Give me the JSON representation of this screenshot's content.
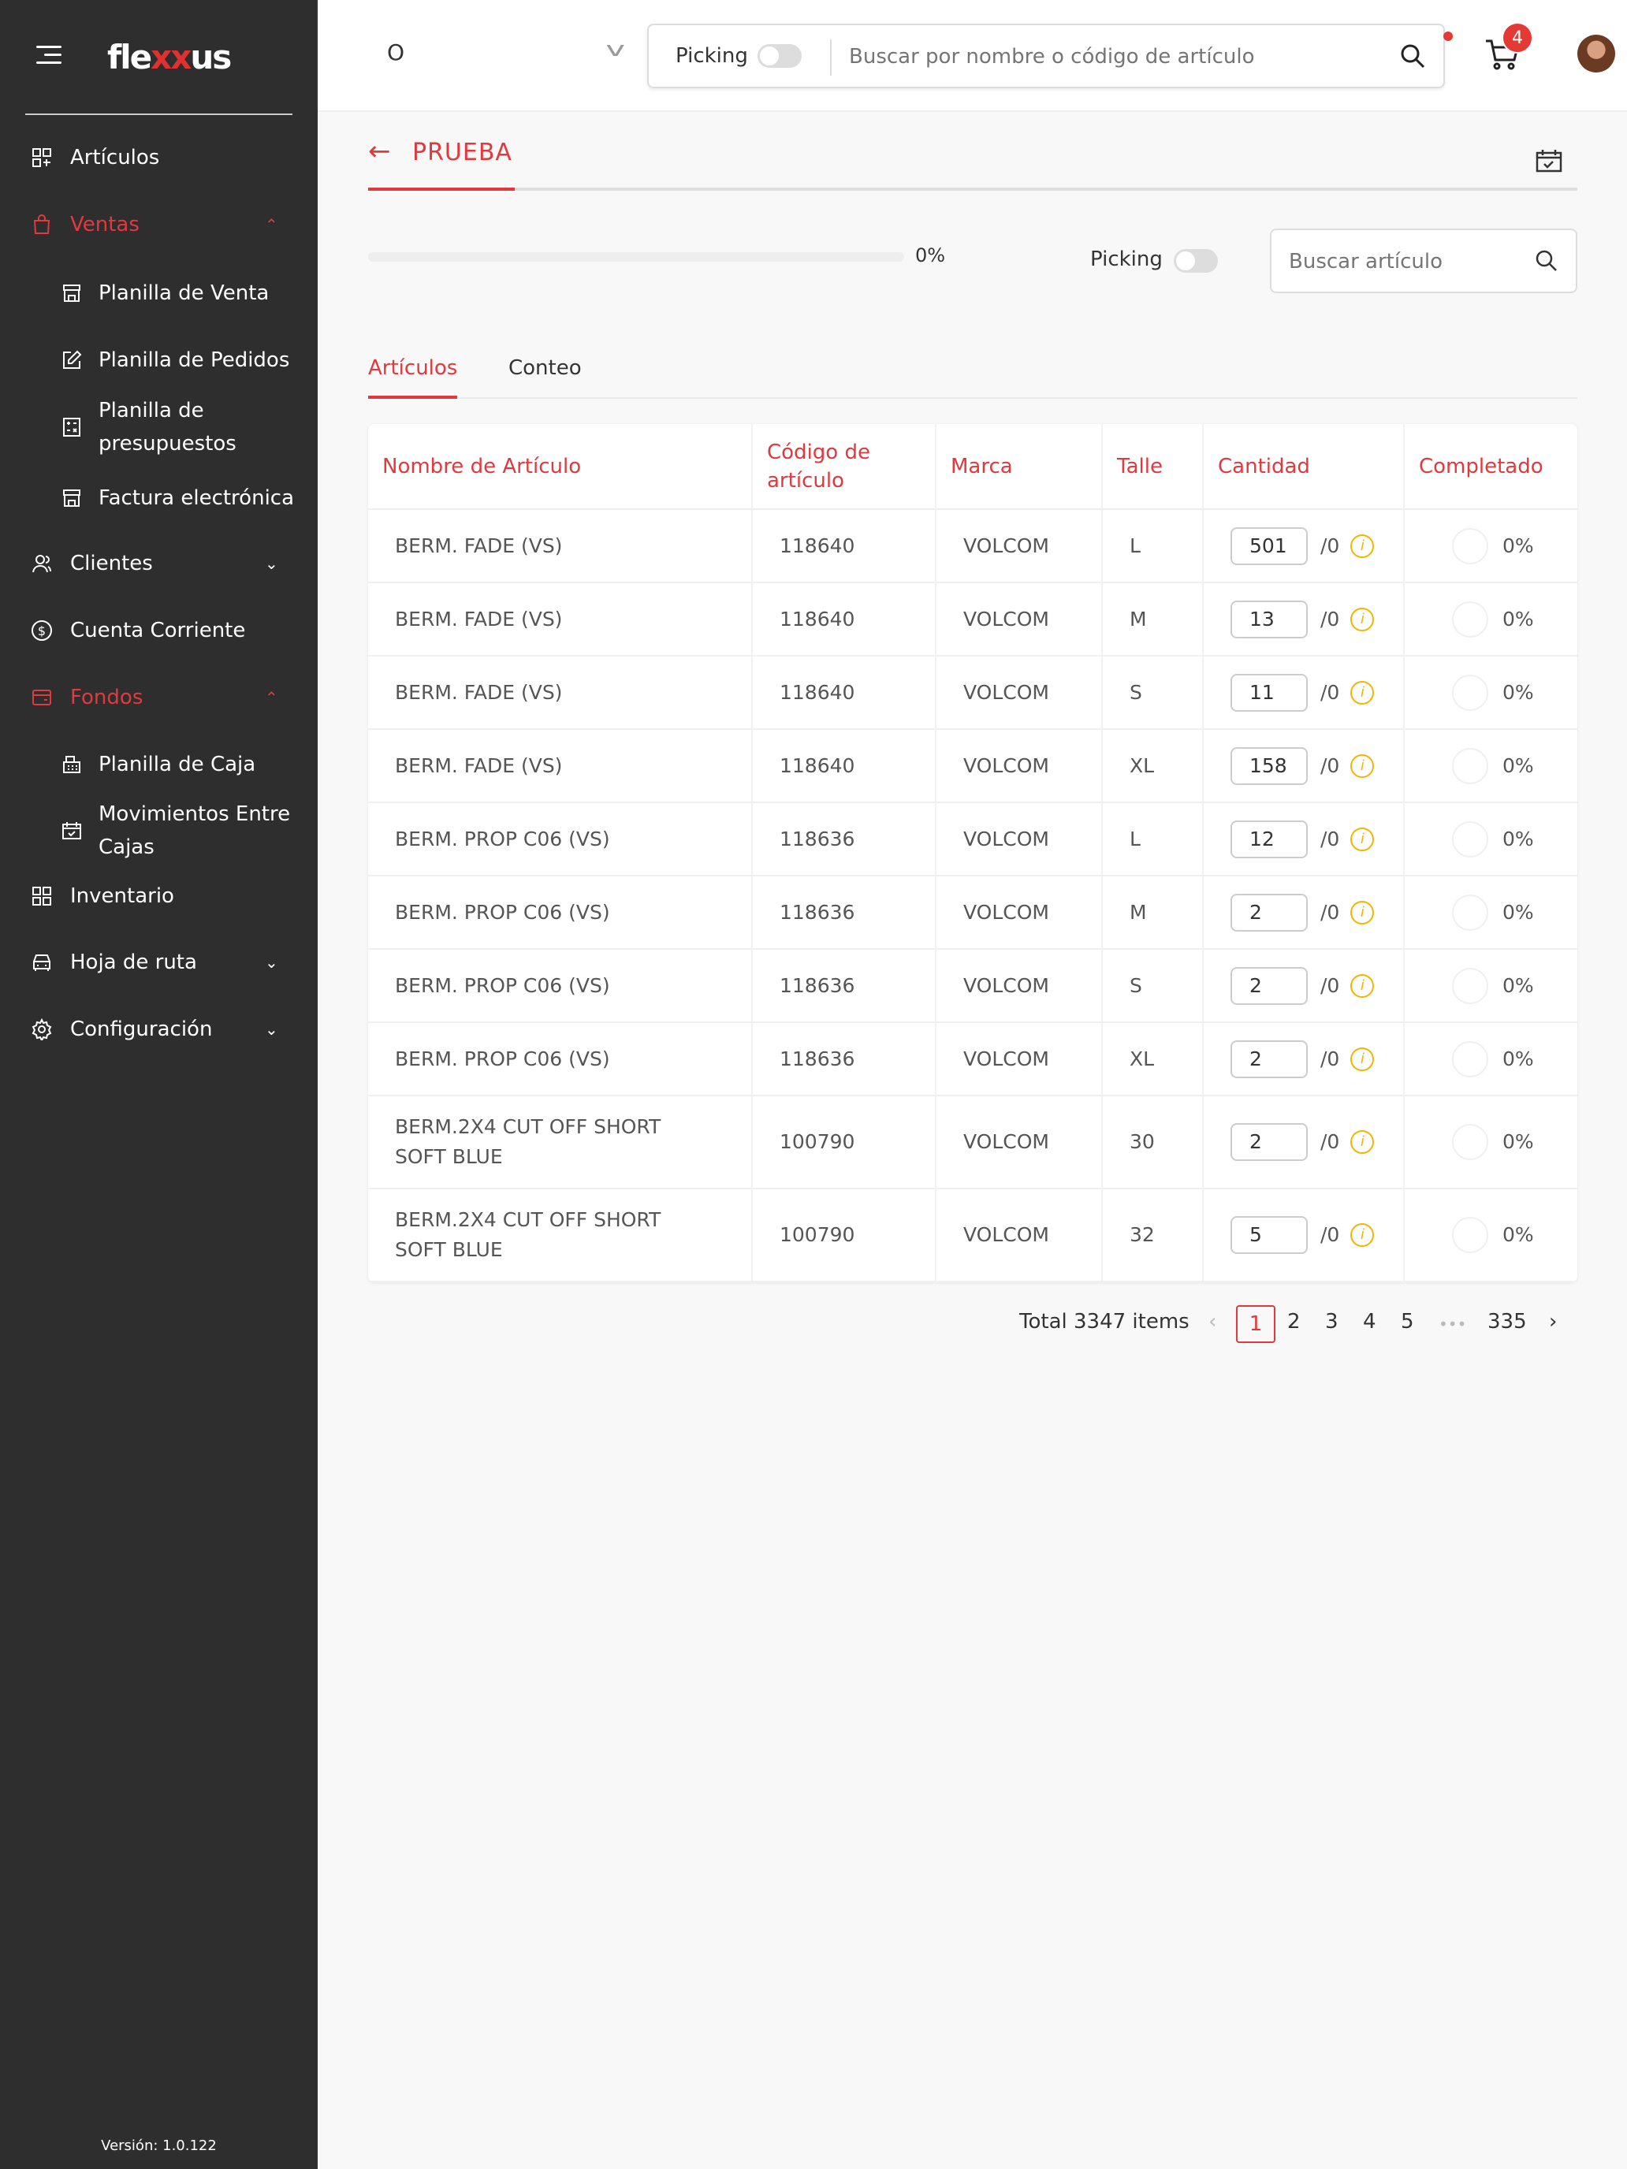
{
  "app": {
    "logo": "flexxus",
    "version": "Versión: 1.0.122"
  },
  "sidebar": {
    "items": [
      {
        "label": "Artículos",
        "icon": "grid-add-icon"
      },
      {
        "label": "Ventas",
        "icon": "bag-icon",
        "active": true,
        "expanded": true
      },
      {
        "label": "Planilla de Venta",
        "icon": "store-icon"
      },
      {
        "label": "Planilla de Pedidos",
        "icon": "edit-icon"
      },
      {
        "label": "Planilla de presupuestos",
        "icon": "calculator-icon"
      },
      {
        "label": "Factura electrónica",
        "icon": "store-icon"
      },
      {
        "label": "Clientes",
        "icon": "users-icon"
      },
      {
        "label": "Cuenta Corriente",
        "icon": "dollar-icon"
      },
      {
        "label": "Fondos",
        "icon": "wallet-icon",
        "active": true,
        "expanded": true
      },
      {
        "label": "Planilla de Caja",
        "icon": "cash-register-icon"
      },
      {
        "label": "Movimientos Entre Cajas",
        "icon": "calendar-check-icon"
      },
      {
        "label": "Inventario",
        "icon": "grid-icon"
      },
      {
        "label": "Hoja de ruta",
        "icon": "car-icon"
      },
      {
        "label": "Configuración",
        "icon": "gear-icon"
      }
    ]
  },
  "topbar": {
    "selector_value": "O",
    "picking_label": "Picking",
    "search_placeholder": "Buscar por nombre o código de artículo",
    "cart_count": "4"
  },
  "page": {
    "title": "PRUEBA",
    "progress_percent": 0,
    "progress_label": "0%",
    "picking_label": "Picking",
    "search_placeholder": "Buscar artículo",
    "tabs": [
      "Artículos",
      "Conteo"
    ]
  },
  "table": {
    "headers": [
      "Nombre de Artículo",
      "Código de artículo",
      "Marca",
      "Talle",
      "Cantidad",
      "Completado"
    ],
    "rows": [
      {
        "name": "BERM. FADE (VS)",
        "code": "118640",
        "brand": "VOLCOM",
        "size": "L",
        "qty": "501",
        "of": "/0",
        "done": "0%"
      },
      {
        "name": "BERM. FADE (VS)",
        "code": "118640",
        "brand": "VOLCOM",
        "size": "M",
        "qty": "13",
        "of": "/0",
        "done": "0%"
      },
      {
        "name": "BERM. FADE (VS)",
        "code": "118640",
        "brand": "VOLCOM",
        "size": "S",
        "qty": "11",
        "of": "/0",
        "done": "0%"
      },
      {
        "name": "BERM. FADE (VS)",
        "code": "118640",
        "brand": "VOLCOM",
        "size": "XL",
        "qty": "158",
        "of": "/0",
        "done": "0%"
      },
      {
        "name": "BERM. PROP C06 (VS)",
        "code": "118636",
        "brand": "VOLCOM",
        "size": "L",
        "qty": "12",
        "of": "/0",
        "done": "0%"
      },
      {
        "name": "BERM. PROP C06 (VS)",
        "code": "118636",
        "brand": "VOLCOM",
        "size": "M",
        "qty": "2",
        "of": "/0",
        "done": "0%"
      },
      {
        "name": "BERM. PROP C06 (VS)",
        "code": "118636",
        "brand": "VOLCOM",
        "size": "S",
        "qty": "2",
        "of": "/0",
        "done": "0%"
      },
      {
        "name": "BERM. PROP C06 (VS)",
        "code": "118636",
        "brand": "VOLCOM",
        "size": "XL",
        "qty": "2",
        "of": "/0",
        "done": "0%"
      },
      {
        "name": "BERM.2X4 CUT OFF SHORT SOFT BLUE",
        "code": "100790",
        "brand": "VOLCOM",
        "size": "30",
        "qty": "2",
        "of": "/0",
        "done": "0%"
      },
      {
        "name": "BERM.2X4 CUT OFF SHORT SOFT BLUE",
        "code": "100790",
        "brand": "VOLCOM",
        "size": "32",
        "qty": "5",
        "of": "/0",
        "done": "0%"
      }
    ]
  },
  "pagination": {
    "total": "Total 3347 items",
    "pages": [
      "1",
      "2",
      "3",
      "4",
      "5"
    ],
    "ellipsis": "•••",
    "last": "335",
    "current": "1"
  },
  "colors": {
    "accent": "#e0393e",
    "sidebar_bg": "#2e2e2e",
    "warning": "#f4b400"
  }
}
